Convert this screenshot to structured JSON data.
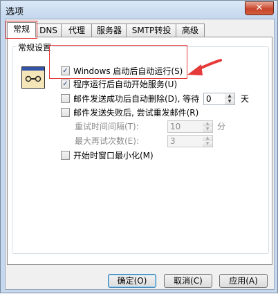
{
  "window": {
    "title": "选项",
    "close_glyph": "✕"
  },
  "tabs": [
    {
      "label": "常规",
      "active": true
    },
    {
      "label": "DNS",
      "active": false
    },
    {
      "label": "代理",
      "active": false
    },
    {
      "label": "服务器",
      "active": false
    },
    {
      "label": "SMTP转投",
      "active": false
    },
    {
      "label": "高级",
      "active": false
    }
  ],
  "general": {
    "group_label": "常规设置",
    "icon": "app-settings-icon",
    "options": {
      "start_with_windows": {
        "label": "Windows 启动后自动运行(S)",
        "checked": true
      },
      "start_service": {
        "label": "程序运行后自动开始服务(U)",
        "checked": true
      },
      "auto_delete": {
        "label": "邮件发送成功后自动删除(D), 等待",
        "checked": false,
        "value": "0",
        "unit": "天"
      },
      "resend_on_fail": {
        "label": "邮件发送失败后, 尝试重发邮件(R)",
        "checked": false
      },
      "retry_interval": {
        "label": "重试时间间隔(T):",
        "value": "10",
        "unit": "分"
      },
      "max_retries": {
        "label": "最大再试次数(E):",
        "value": "3"
      },
      "minimize_on_start": {
        "label": "开始时窗口最小化(M)",
        "checked": false
      }
    }
  },
  "buttons": {
    "ok": "确定(O)",
    "cancel": "取消(C)",
    "apply": "应用(A)"
  },
  "colors": {
    "highlight": "#e5393a"
  }
}
